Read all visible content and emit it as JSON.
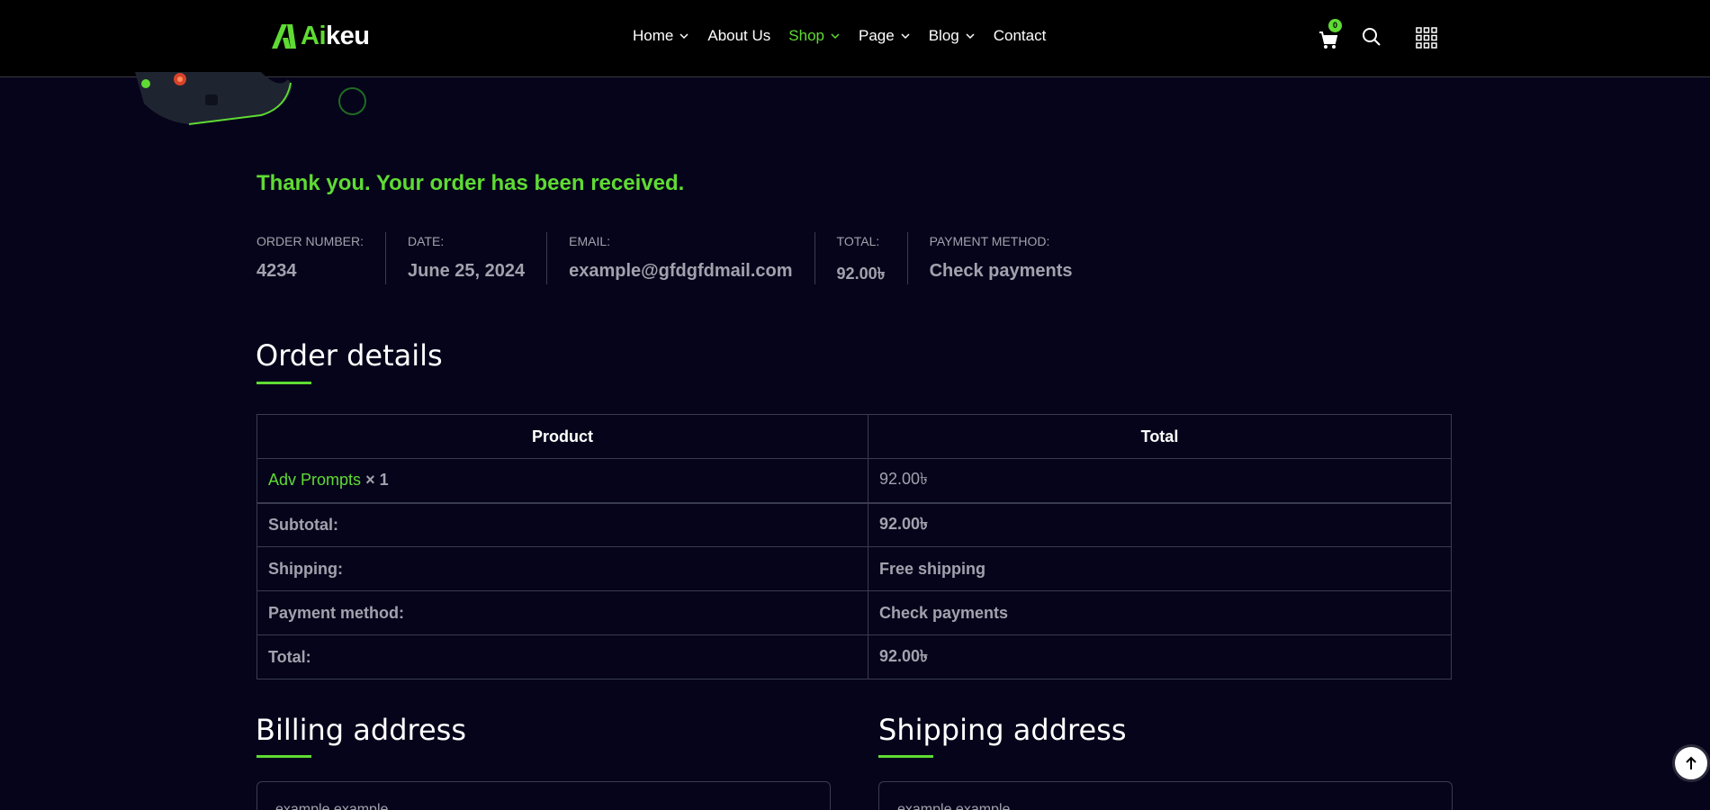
{
  "header": {
    "logo_ai": "Ai",
    "logo_rest": "keu",
    "nav": [
      {
        "label": "Home",
        "has_dropdown": true,
        "active": false
      },
      {
        "label": "About Us",
        "has_dropdown": false,
        "active": false
      },
      {
        "label": "Shop",
        "has_dropdown": true,
        "active": true
      },
      {
        "label": "Page",
        "has_dropdown": true,
        "active": false
      },
      {
        "label": "Blog",
        "has_dropdown": true,
        "active": false
      },
      {
        "label": "Contact",
        "has_dropdown": false,
        "active": false
      }
    ],
    "cart_count": "0",
    "icons": [
      "cart-icon",
      "search-icon",
      "grid-menu-icon"
    ]
  },
  "order": {
    "thank_you": "Thank you. Your order has been received.",
    "overview": [
      {
        "label": "ORDER NUMBER:",
        "value": "4234"
      },
      {
        "label": "DATE:",
        "value": "June 25, 2024"
      },
      {
        "label": "EMAIL:",
        "value": "example@gfdgfdmail.com"
      },
      {
        "label": "TOTAL:",
        "value": "92.00৳"
      },
      {
        "label": "PAYMENT METHOD:",
        "value": "Check payments"
      }
    ]
  },
  "order_details": {
    "title": "Order details",
    "headers": {
      "product": "Product",
      "total": "Total"
    },
    "item": {
      "name": "Adv Prompts",
      "qty": "× 1",
      "total": "92.00৳"
    },
    "rows": [
      {
        "label": "Subtotal:",
        "value": "92.00৳"
      },
      {
        "label": "Shipping:",
        "value": "Free shipping"
      },
      {
        "label": "Payment method:",
        "value": "Check payments"
      },
      {
        "label": "Total:",
        "value": "92.00৳"
      }
    ]
  },
  "billing": {
    "title": "Billing address",
    "name": "example example"
  },
  "shipping": {
    "title": "Shipping address",
    "name": "example example"
  },
  "colors": {
    "accent": "#5fdb33",
    "background": "#05041a",
    "header": "#000000",
    "muted": "#a2a2ae"
  }
}
